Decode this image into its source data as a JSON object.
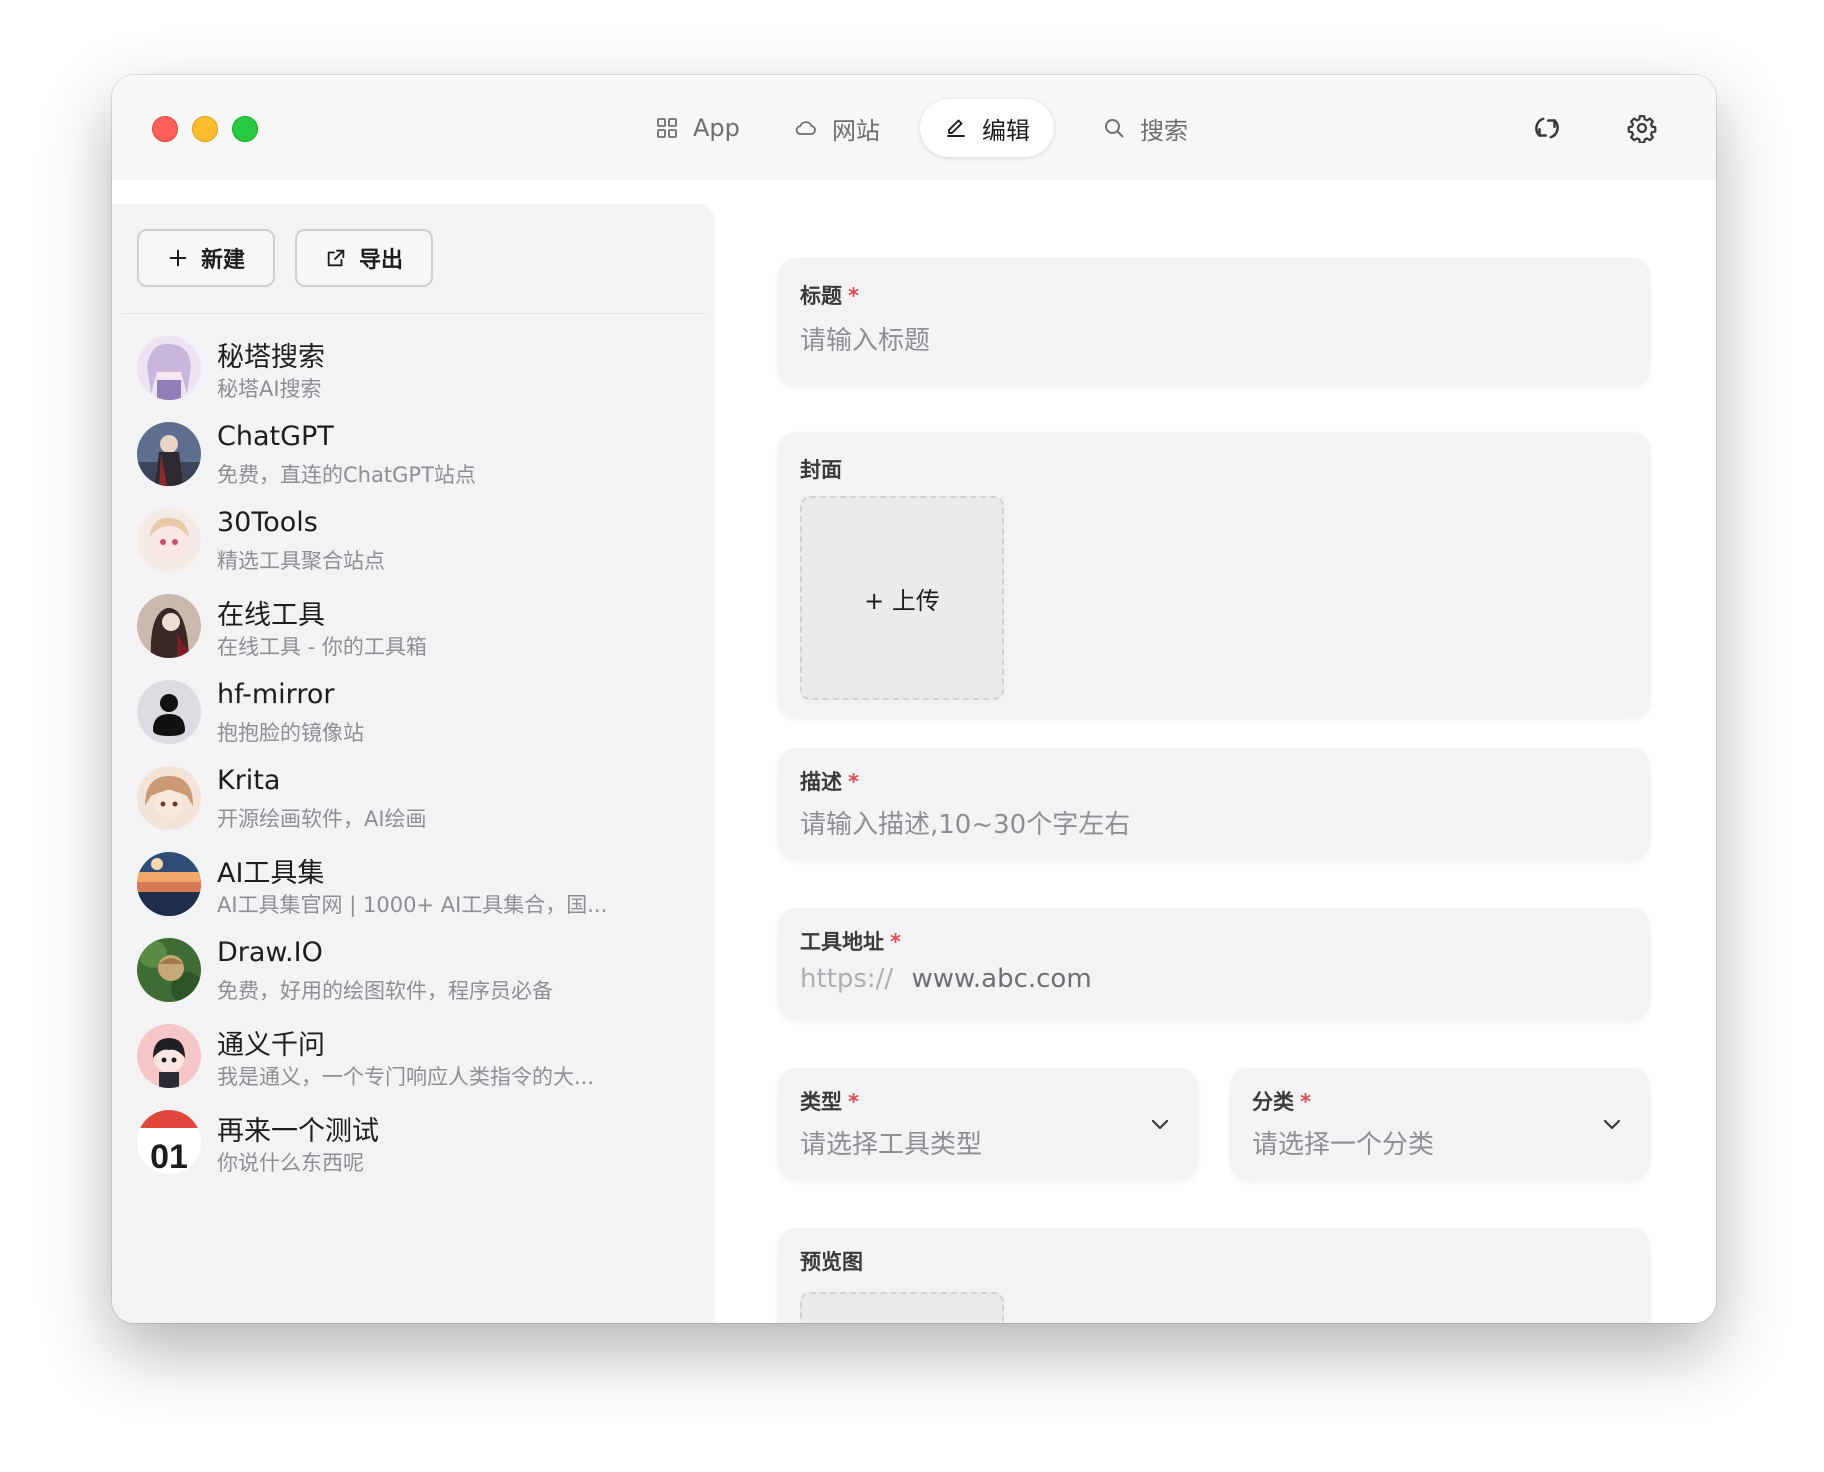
{
  "nav": {
    "tabs": [
      {
        "label": "App",
        "icon": "grid-icon"
      },
      {
        "label": "网站",
        "icon": "cloud-icon"
      },
      {
        "label": "编辑",
        "icon": "pencil-icon",
        "active": true
      },
      {
        "label": "搜索",
        "icon": "search-icon"
      }
    ],
    "right_icons": [
      "sync-icon",
      "gear-icon"
    ]
  },
  "toolbar": {
    "new_label": "新建",
    "export_label": "导出"
  },
  "sidebar": {
    "items": [
      {
        "title": "秘塔搜索",
        "desc": "秘塔AI搜索"
      },
      {
        "title": "ChatGPT",
        "desc": "免费，直连的ChatGPT站点"
      },
      {
        "title": "30Tools",
        "desc": "精选工具聚合站点"
      },
      {
        "title": "在线工具",
        "desc": "在线工具 - 你的工具箱"
      },
      {
        "title": "hf-mirror",
        "desc": "抱抱脸的镜像站"
      },
      {
        "title": "Krita",
        "desc": "开源绘画软件，AI绘画"
      },
      {
        "title": "AI工具集",
        "desc": "AI工具集官网 | 1000+ AI工具集合，国..."
      },
      {
        "title": "Draw.IO",
        "desc": "免费，好用的绘图软件，程序员必备"
      },
      {
        "title": "通义千问",
        "desc": "我是通义，一个专门响应人类指令的大..."
      },
      {
        "title": "再来一个测试",
        "desc": "你说什么东西呢",
        "avatar_text": "01"
      }
    ]
  },
  "form": {
    "title_label": "标题",
    "title_placeholder": "请输入标题",
    "cover_label": "封面",
    "upload_label": "+ 上传",
    "desc_label": "描述",
    "desc_placeholder": "请输入描述,10~30个字左右",
    "url_label": "工具地址",
    "url_prefix": "https://",
    "url_placeholder": "www.abc.com",
    "type_label": "类型",
    "type_placeholder": "请选择工具类型",
    "category_label": "分类",
    "category_placeholder": "请选择一个分类",
    "preview_label": "预览图",
    "required_mark": "*"
  },
  "colors": {
    "accent_required": "#e5484d",
    "window_bg": "#f7f7f8",
    "card_bg": "#f3f3f5"
  }
}
